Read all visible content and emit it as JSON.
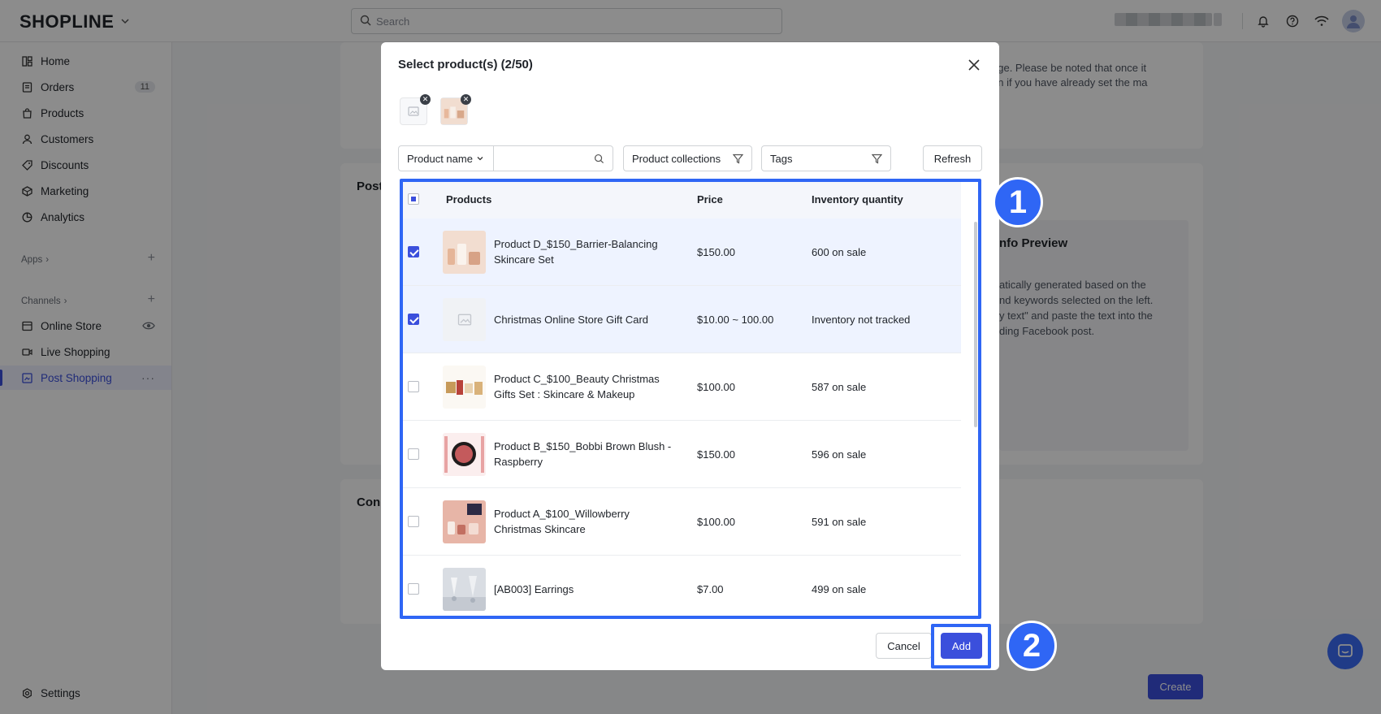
{
  "app": {
    "logo": "SHOPLINE",
    "search_placeholder": "Search"
  },
  "sidebar": {
    "items": [
      {
        "label": "Home",
        "icon": "home-icon"
      },
      {
        "label": "Orders",
        "icon": "orders-icon",
        "badge": "11"
      },
      {
        "label": "Products",
        "icon": "products-icon"
      },
      {
        "label": "Customers",
        "icon": "customers-icon"
      },
      {
        "label": "Discounts",
        "icon": "discounts-icon"
      },
      {
        "label": "Marketing",
        "icon": "marketing-icon"
      },
      {
        "label": "Analytics",
        "icon": "analytics-icon"
      }
    ],
    "apps_label": "Apps",
    "channels_label": "Channels",
    "channels": [
      {
        "label": "Online Store",
        "icon": "store-icon"
      },
      {
        "label": "Live Shopping",
        "icon": "live-icon"
      },
      {
        "label": "Post Shopping",
        "icon": "post-icon",
        "active": true
      }
    ],
    "settings_label": "Settings"
  },
  "background": {
    "notice_line1": "age. Please be noted that once it",
    "notice_line2": "en if you have already set the ma",
    "post_title": "Post",
    "preview_title": "nfo Preview",
    "preview_line1": "atically generated based on the",
    "preview_line2": "nd keywords selected on the left.",
    "preview_line3": "y text\" and paste the text into the",
    "preview_line4": "ding Facebook post.",
    "conn_title": "Conn",
    "create_label": "Create"
  },
  "modal": {
    "title": "Select product(s)  (2/50)",
    "filter_field": "Product name",
    "collections_label": "Product collections",
    "tags_label": "Tags",
    "refresh_label": "Refresh",
    "columns": {
      "products": "Products",
      "price": "Price",
      "inventory": "Inventory quantity"
    },
    "rows": [
      {
        "name": "Product D_$150_Barrier-Balancing Skincare Set",
        "price": "$150.00",
        "inventory": "600 on sale",
        "checked": true
      },
      {
        "name": "Christmas Online Store Gift Card",
        "price": "$10.00 ~ 100.00",
        "inventory": "Inventory not tracked",
        "checked": true
      },
      {
        "name": "Product C_$100_Beauty Christmas Gifts Set : Skincare & Makeup",
        "price": "$100.00",
        "inventory": "587 on sale",
        "checked": false
      },
      {
        "name": "Product B_$150_Bobbi Brown Blush - Raspberry",
        "price": "$150.00",
        "inventory": "596 on sale",
        "checked": false
      },
      {
        "name": "Product A_$100_Willowberry Christmas Skincare",
        "price": "$100.00",
        "inventory": "591 on sale",
        "checked": false
      },
      {
        "name": "[AB003] Earrings",
        "price": "$7.00",
        "inventory": "499 on sale",
        "checked": false
      }
    ],
    "cancel_label": "Cancel",
    "add_label": "Add"
  },
  "annotations": {
    "step1": "1",
    "step2": "2",
    "color": "#2f66f5"
  }
}
